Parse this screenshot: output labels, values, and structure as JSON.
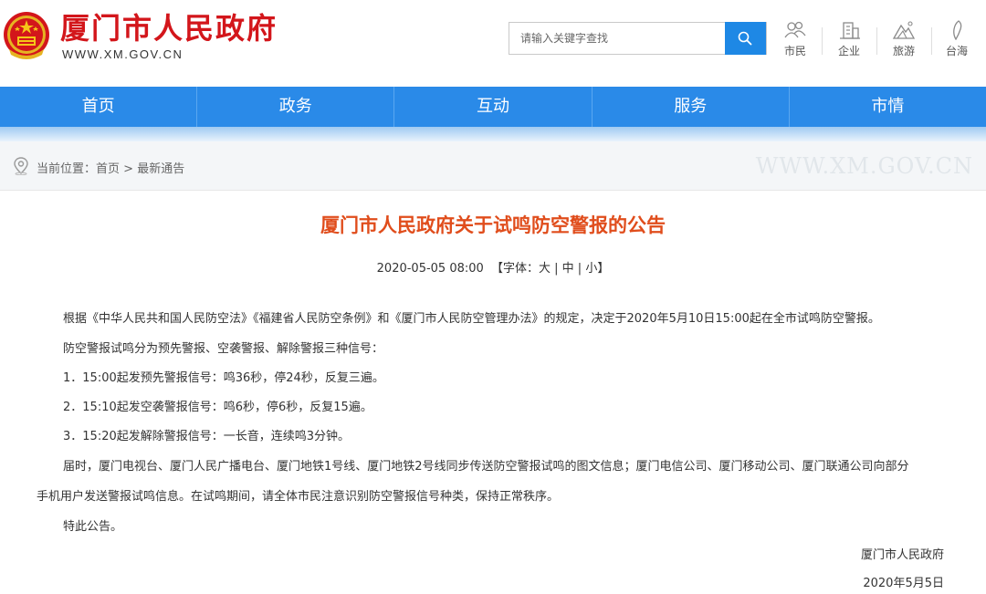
{
  "header": {
    "site_title": "厦门市人民政府",
    "site_domain": "WWW.XM.GOV.CN",
    "search": {
      "placeholder": "请输入关键字查找",
      "icon": "search-icon"
    },
    "quick_links": [
      {
        "label": "市民",
        "icon": "citizen-icon"
      },
      {
        "label": "企业",
        "icon": "enterprise-icon"
      },
      {
        "label": "旅游",
        "icon": "tourism-icon"
      },
      {
        "label": "台海",
        "icon": "taiwan-icon"
      }
    ]
  },
  "nav": {
    "items": [
      "首页",
      "政务",
      "互动",
      "服务",
      "市情"
    ]
  },
  "breadcrumb": {
    "prefix": "当前位置：",
    "home": "首页",
    "separator": " > ",
    "current": "最新通告",
    "watermark": "WWW.XM.GOV.CN"
  },
  "article": {
    "title": "厦门市人民政府关于试鸣防空警报的公告",
    "date": "2020-05-05 08:00",
    "font_label_open": "【字体：",
    "font_large": "大",
    "font_medium": "中",
    "font_small": "小",
    "font_label_close": "】",
    "font_sep": " | ",
    "paragraphs": [
      "根据《中华人民共和国人民防空法》《福建省人民防空条例》和《厦门市人民防空管理办法》的规定，决定于2020年5月10日15:00起在全市试鸣防空警报。",
      "防空警报试鸣分为预先警报、空袭警报、解除警报三种信号：",
      "1．15:00起发预先警报信号：鸣36秒，停24秒，反复三遍。",
      "2．15:10起发空袭警报信号：鸣6秒，停6秒，反复15遍。",
      "3．15:20起发解除警报信号：一长音，连续鸣3分钟。",
      "届时，厦门电视台、厦门人民广播电台、厦门地铁1号线、厦门地铁2号线同步传送防空警报试鸣的图文信息；厦门电信公司、厦门移动公司、厦门联通公司向部分",
      "手机用户发送警报试鸣信息。在试鸣期间，请全体市民注意识别防空警报信号种类，保持正常秩序。",
      "特此公告。"
    ],
    "signature": "厦门市人民政府",
    "sign_date": "2020年5月5日"
  },
  "colors": {
    "brand_red": "#d3161b",
    "nav_blue": "#2a8ae8",
    "title_orange": "#e04d1c"
  }
}
